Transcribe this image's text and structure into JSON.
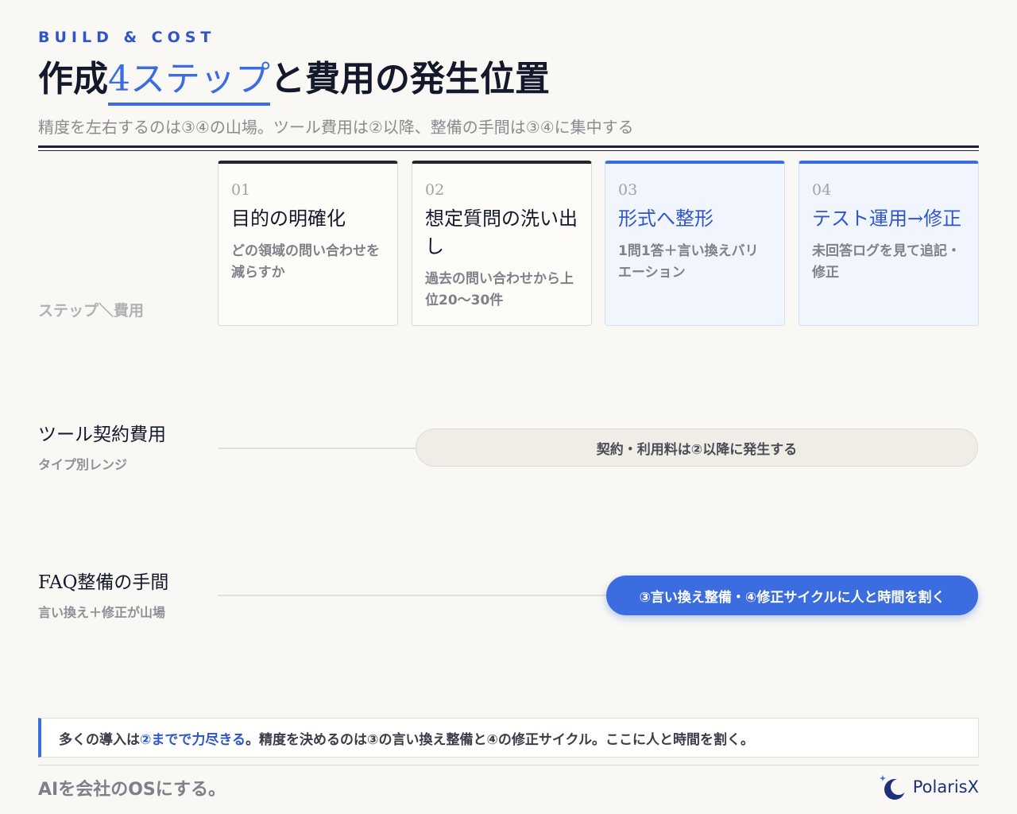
{
  "header": {
    "eyebrow": "BUILD & COST",
    "title_pre": "作成",
    "title_accent": "4ステップ",
    "title_post": "と費用の発生位置",
    "subtitle": "精度を左右するのは③④の山場。ツール費用は②以降、整備の手間は③④に集中する"
  },
  "grid": {
    "corner_label": "ステップ＼費用"
  },
  "steps": [
    {
      "num": "01",
      "title": "目的の明確化",
      "desc": "どの領域の問い合わせを減らすか"
    },
    {
      "num": "02",
      "title": "想定質問の洗い出し",
      "desc": "過去の問い合わせから上位20〜30件"
    },
    {
      "num": "03",
      "title": "形式へ整形",
      "desc": "1問1答＋言い換えバリエーション"
    },
    {
      "num": "04",
      "title": "テスト運用→修正",
      "desc": "未回答ログを見て追記・修正"
    }
  ],
  "rows": {
    "tool": {
      "title": "ツール契約費用",
      "sub": "タイプ別レンジ",
      "bar": "契約・利用料は②以降に発生する"
    },
    "faq": {
      "title": "FAQ整備の手間",
      "sub": "言い換え＋修正が山場",
      "bar": "③言い換え整備・④修正サイクルに人と時間を割く"
    }
  },
  "note": {
    "pre": "多くの導入は",
    "em": "②までで力尽きる",
    "post": "。精度を決めるのは③の言い換え整備と④の修正サイクル。ここに人と時間を割く。"
  },
  "footer": {
    "tagline": "AIを会社のOSにする。",
    "logo_text": "PolarisX"
  },
  "colors": {
    "accent": "#3b6de0",
    "ink": "#14182b",
    "paper": "#f9f8f5"
  }
}
